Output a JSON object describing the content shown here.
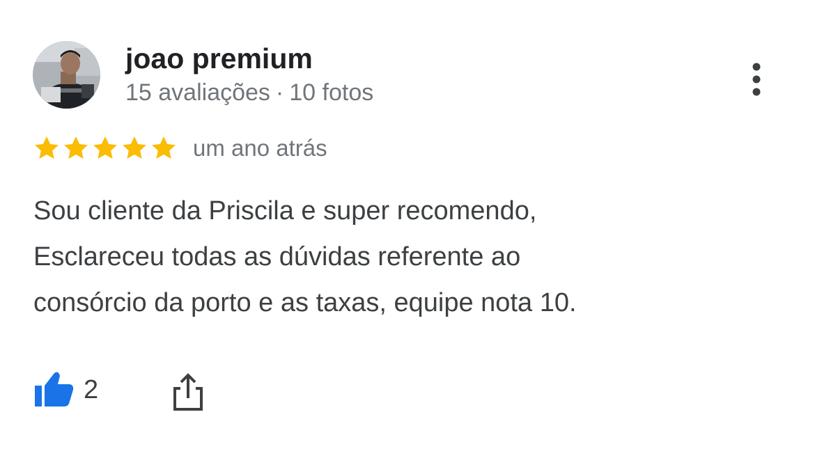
{
  "reviewer": {
    "name": "joao premium",
    "reviews_count": "15 avaliações",
    "separator": "·",
    "photos_count": "10 fotos",
    "avatar_icon": "profile-photo"
  },
  "rating": {
    "stars": 5,
    "max": 5,
    "color": "#fbbc04",
    "time_ago": "um ano atrás"
  },
  "review": {
    "lines": [
      "Sou cliente da Priscila e super recomendo,",
      "Esclareceu todas as dúvidas referente ao",
      "consórcio da porto e as taxas, equipe nota 10."
    ]
  },
  "actions": {
    "like_icon": "thumbs-up-icon",
    "like_count": "2",
    "like_color": "#1a73e8",
    "share_icon": "share-icon",
    "more_icon": "more-vertical-icon"
  }
}
